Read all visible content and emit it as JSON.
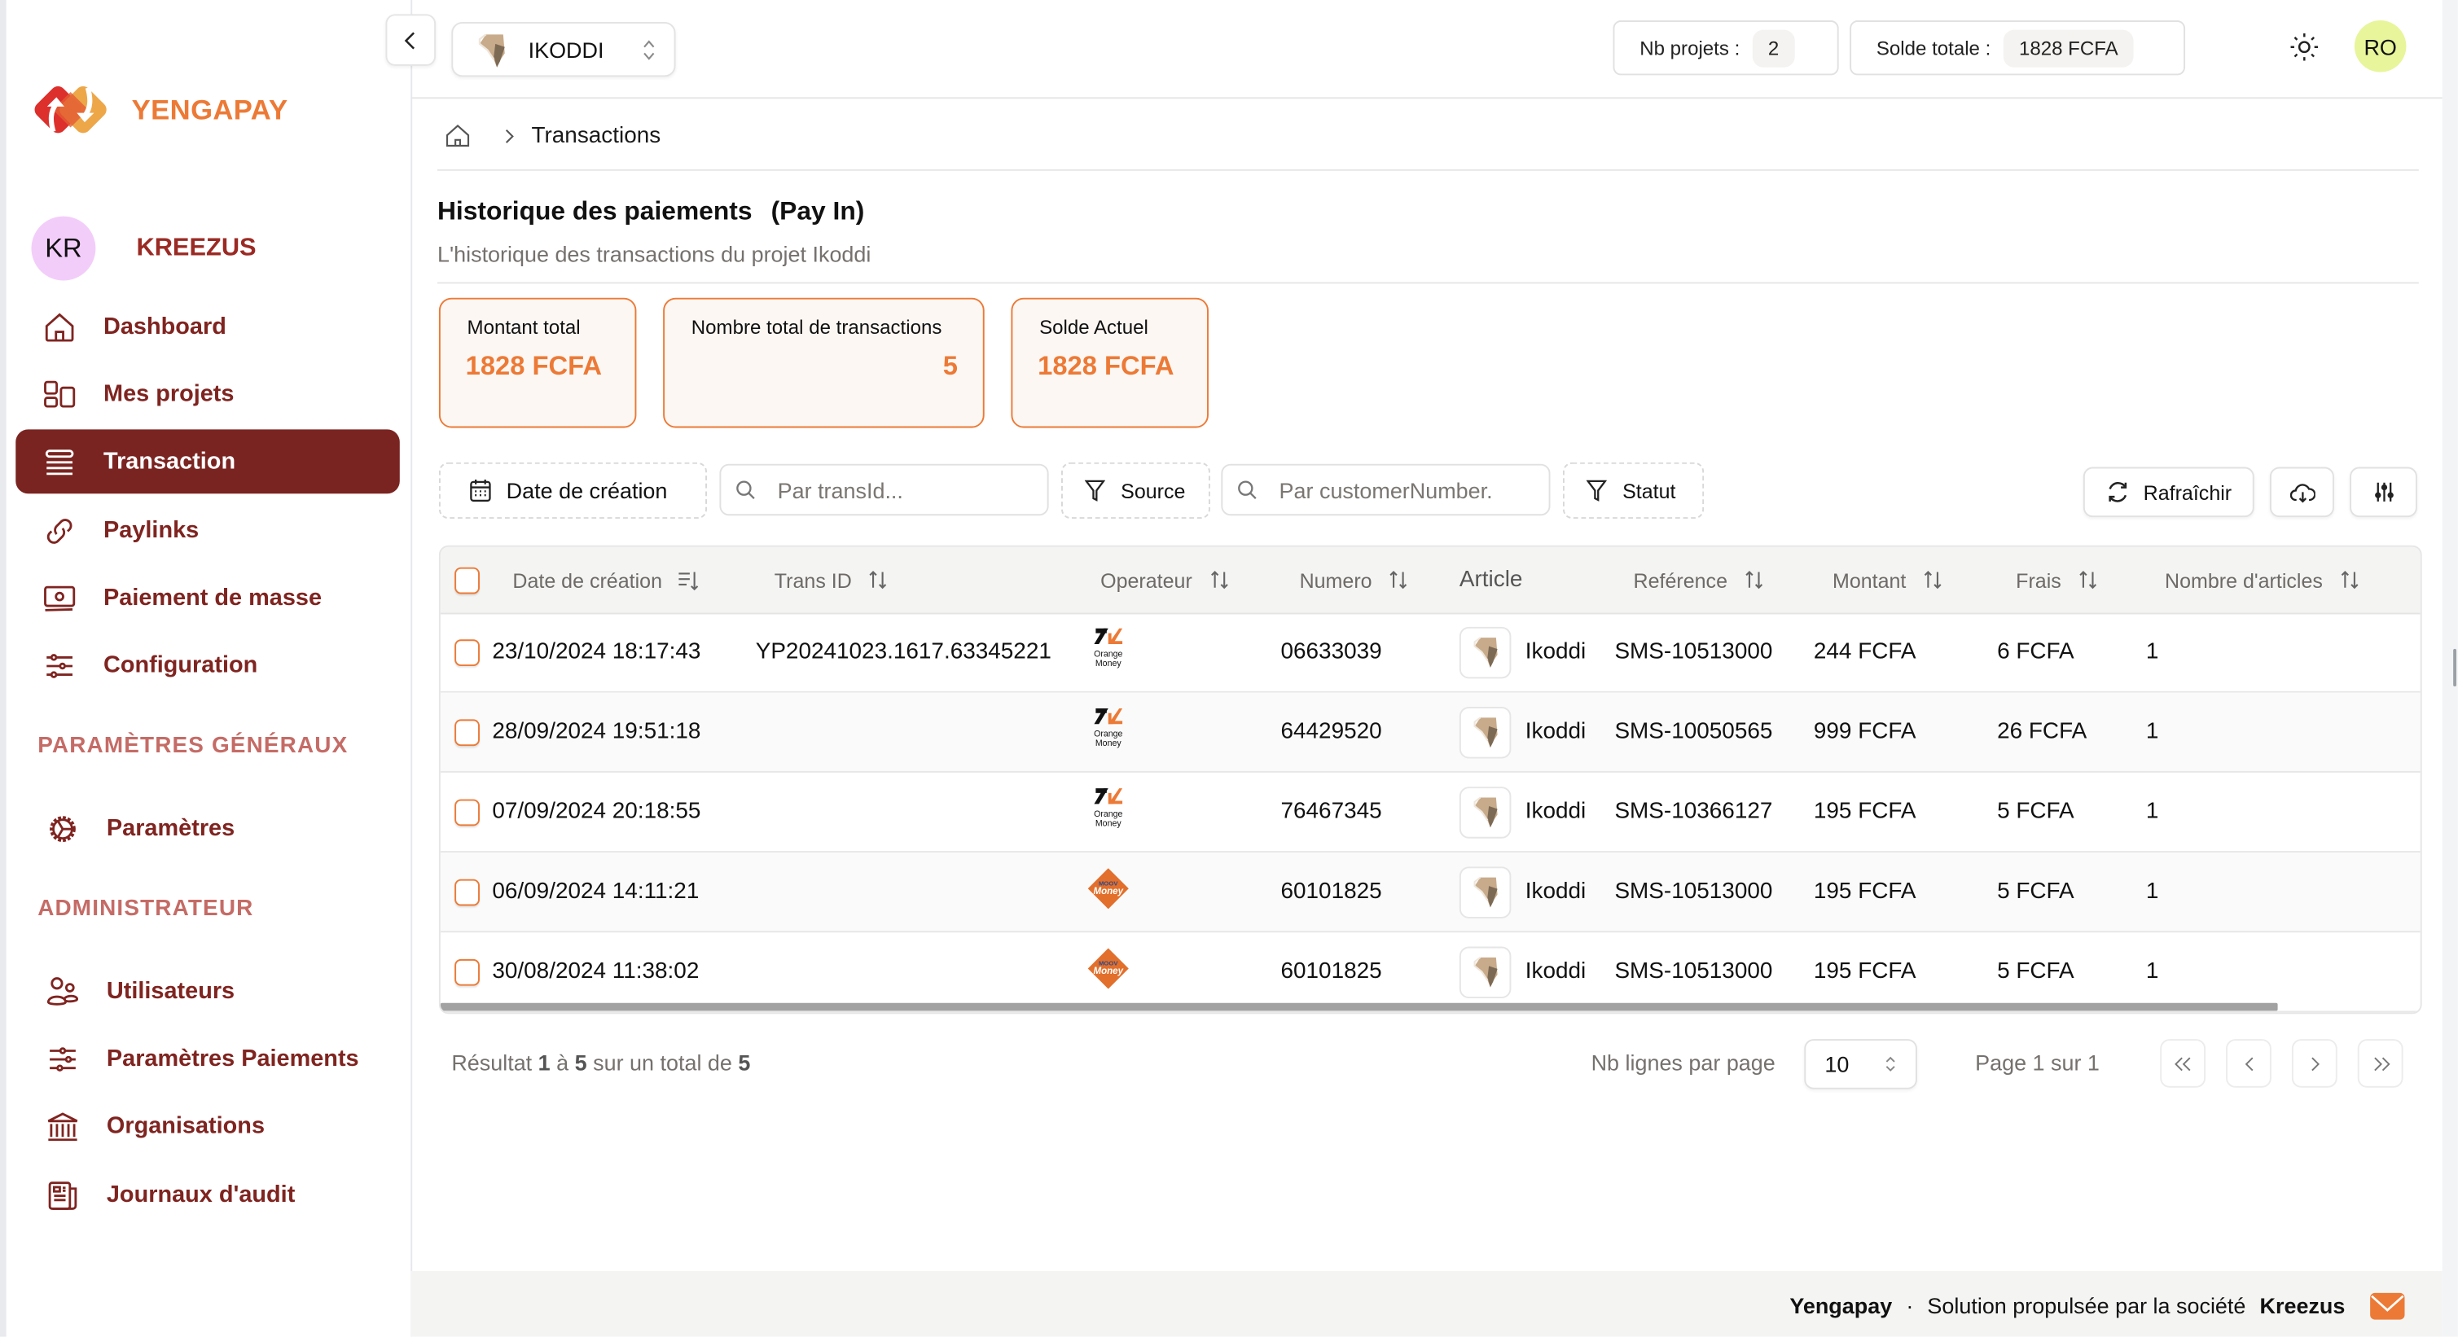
{
  "app": {
    "brand": "YENGAPAY",
    "brand_color": "#ec7a36",
    "accent_dark": "#7a2421"
  },
  "organization": {
    "initials": "KR",
    "name": "KREEZUS"
  },
  "sidebar": {
    "items": [
      {
        "label": "Dashboard",
        "icon": "home-icon",
        "active": false
      },
      {
        "label": "Mes projets",
        "icon": "projects-grid-icon",
        "active": false
      },
      {
        "label": "Transaction",
        "icon": "list-icon",
        "active": true
      },
      {
        "label": "Paylinks",
        "icon": "link-icon",
        "active": false
      },
      {
        "label": "Paiement de masse",
        "icon": "banknote-icon",
        "active": false
      },
      {
        "label": "Configuration",
        "icon": "sliders-icon",
        "active": false
      }
    ],
    "sections": [
      {
        "title": "PARAMÈTRES GÉNÉRAUX",
        "items": [
          {
            "label": "Paramètres",
            "icon": "gear-icon"
          }
        ]
      },
      {
        "title": "ADMINISTRATEUR",
        "items": [
          {
            "label": "Utilisateurs",
            "icon": "users-icon"
          },
          {
            "label": "Paramètres Paiements",
            "icon": "sliders-icon"
          },
          {
            "label": "Organisations",
            "icon": "bank-icon"
          },
          {
            "label": "Journaux d'audit",
            "icon": "newspaper-icon"
          }
        ]
      }
    ]
  },
  "topbar": {
    "project_selector": {
      "value": "IKODDI"
    },
    "nb_projets": {
      "label": "Nb projets :",
      "value": "2"
    },
    "solde_totale": {
      "label": "Solde totale :",
      "value": "1828 FCFA"
    },
    "user_initials": "RO"
  },
  "breadcrumb": {
    "home_icon": "home-icon",
    "current": "Transactions"
  },
  "page": {
    "title": "Historique des paiements",
    "title_suffix": "(Pay In)",
    "subtitle": "L'historique des transactions du projet Ikoddi"
  },
  "kpis": [
    {
      "label": "Montant total",
      "value": "1828 FCFA"
    },
    {
      "label": "Nombre total de transactions",
      "value": "5"
    },
    {
      "label": "Solde Actuel",
      "value": "1828 FCFA"
    }
  ],
  "filters": {
    "date_button": "Date de création",
    "transid_placeholder": "Par transId...",
    "source_button": "Source",
    "customer_placeholder": "Par customerNumber.",
    "statut_button": "Statut",
    "refresh_button": "Rafraîchir"
  },
  "table": {
    "columns": [
      {
        "label": "Date de création",
        "sort": "sorted-desc"
      },
      {
        "label": "Trans ID",
        "sort": "sortable"
      },
      {
        "label": "Operateur",
        "sort": "sortable"
      },
      {
        "label": "Numero",
        "sort": "sortable"
      },
      {
        "label": "Article",
        "sort": "none"
      },
      {
        "label": "Reférence",
        "sort": "sortable"
      },
      {
        "label": "Montant",
        "sort": "sortable"
      },
      {
        "label": "Frais",
        "sort": "sortable"
      },
      {
        "label": "Nombre d'articles",
        "sort": "sortable"
      }
    ],
    "rows": [
      {
        "date": "23/10/2024 18:17:43",
        "trans_id": "YP20241023.1617.63345221",
        "operateur": "Orange Money",
        "numero": "06633039",
        "article": "Ikoddi",
        "reference": "SMS-10513000",
        "montant": "244 FCFA",
        "frais": "6 FCFA",
        "nb_articles": "1"
      },
      {
        "date": "28/09/2024 19:51:18",
        "trans_id": "",
        "operateur": "Orange Money",
        "numero": "64429520",
        "article": "Ikoddi",
        "reference": "SMS-10050565",
        "montant": "999 FCFA",
        "frais": "26 FCFA",
        "nb_articles": "1"
      },
      {
        "date": "07/09/2024 20:18:55",
        "trans_id": "",
        "operateur": "Orange Money",
        "numero": "76467345",
        "article": "Ikoddi",
        "reference": "SMS-10366127",
        "montant": "195 FCFA",
        "frais": "5 FCFA",
        "nb_articles": "1"
      },
      {
        "date": "06/09/2024 14:11:21",
        "trans_id": "",
        "operateur": "Moov Money",
        "numero": "60101825",
        "article": "Ikoddi",
        "reference": "SMS-10513000",
        "montant": "195 FCFA",
        "frais": "5 FCFA",
        "nb_articles": "1"
      },
      {
        "date": "30/08/2024 11:38:02",
        "trans_id": "",
        "operateur": "Moov Money",
        "numero": "60101825",
        "article": "Ikoddi",
        "reference": "SMS-10513000",
        "montant": "195 FCFA",
        "frais": "5 FCFA",
        "nb_articles": "1"
      }
    ]
  },
  "pagination": {
    "result_prefix": "Résultat",
    "from": "1",
    "to_word": "à",
    "to": "5",
    "total_word": "sur un total de",
    "total": "5",
    "rows_per_page_label": "Nb lignes par page",
    "rows_per_page": "10",
    "page_info": "Page 1 sur 1"
  },
  "footer": {
    "brand": "Yengapay",
    "separator": "·",
    "text": "Solution propulsée par la société",
    "company": "Kreezus"
  }
}
